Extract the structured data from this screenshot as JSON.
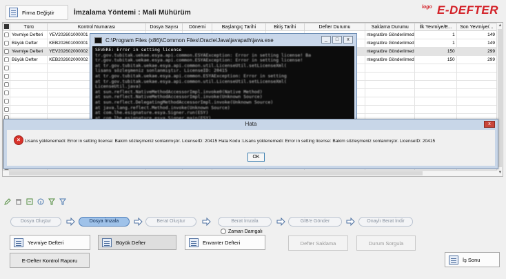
{
  "header": {
    "firm_button": "Firma Değiştir",
    "title": "İmzalama Yöntemi : Mali Mühürüm",
    "logo_small": "logo",
    "logo_big": "E-DEFTER"
  },
  "grid": {
    "columns": [
      "",
      "Türü",
      "Kontrol Numarası",
      "Dosya Sayısı",
      "Dönemi",
      "Başlangıç Tarihi",
      "Bitiş Tarihi",
      "Defter Durumu",
      "Saklama Durumu",
      "İlk Yevmiye/E...",
      "Son Yevmiye/..."
    ],
    "rows": [
      {
        "type": "Yevmiye Defteri",
        "control": "YEV202601000001",
        "saklama": "ntegratöre Gönderilmedi",
        "ilk": "1",
        "son": "149",
        "selected": false
      },
      {
        "type": "Büyük Defter",
        "control": "KEB202601000001",
        "saklama": "ntegratöre Gönderilmedi",
        "ilk": "1",
        "son": "149",
        "selected": false
      },
      {
        "type": "Yevmiye Defteri",
        "control": "YEV202602000002",
        "saklama": "ntegratöre Gönderilmedi",
        "ilk": "150",
        "son": "299",
        "selected": true
      },
      {
        "type": "Büyük Defter",
        "control": "KEB202602000002",
        "saklama": "ntegratöre Gönderilmedi",
        "ilk": "150",
        "son": "299",
        "selected": false
      }
    ],
    "empty_rows": 14
  },
  "console": {
    "title": "C:\\Program Files (x86)\\Common Files\\Oracle\\Java\\javapath\\java.exe",
    "first_line": "SEVERE: Error in setting license",
    "blurred_lines": [
      "tr.gov.tubitak.uekae.esya.api.common.ESYAException: Error in setting license! Ba",
      "tr.gov.tubitak.uekae.esya.api.common.ESYAException: Error in setting license!",
      "   at tr.gov.tubitak.uekae.esya.api.common.util.LicenseUtil.setLicenseXml(",
      "lisans sözleşmeniz sonlanmıştır. LicenseID: 20415",
      "   at tr.gov.tubitak.uekae.esya.api.common.ESYAException: Error in setting",
      "   at tr.gov.tubitak.uekae.esya.api.common.util.LicenseUtil.setLicenseXml(",
      "LicenseUtil.java)",
      "   at sun.reflect.NativeMethodAccessorImpl.invoke0(Native Method)",
      "   at sun.reflect.NativeMethodAccessorImpl.invoke(Unknown Source)",
      "   at sun.reflect.DelegatingMethodAccessorImpl.invoke(Unknown Source)",
      "   at java.lang.reflect.Method.invoke(Unknown Source)",
      "   at com.lhe.esignature.esya.Signer.run(ESY)",
      "   at com.lhe.esignature.esya.Signer.main(ESY)"
    ],
    "min": "_",
    "max": "□",
    "close": "x"
  },
  "dialog": {
    "title": "Hata",
    "close": "x",
    "message": "Lisans yüklenemedi: Error in setting license: Bakim sözleşmeniz sonlanmıştır. LicenseID: 20415 Hata Kodu :Lisans yüklenemedi: Error in setting license: Bakim sözleşmeniz sonlanmıştır. LicenseID: 20415",
    "ok": "OK"
  },
  "workflow": {
    "steps": [
      "Dosya Oluştur",
      "Dosya İmzala",
      "Berat Oluştur",
      "Berat İmzala",
      "GİB'e Gönder",
      "Onaylı Berat İndir"
    ],
    "active": "Dosya İmzala",
    "zaman_damgali": "Zaman Damgalı"
  },
  "actions": {
    "yevmiye": "Yevmiye Defteri",
    "buyuk": "Büyük Defter",
    "envanter": "Envanter Defteri",
    "saklama": "Defter Saklama",
    "sorgula": "Durum Sorgula",
    "rapor": "E-Defter Kontrol Raporu",
    "is_sonu": "İş Sonu"
  },
  "colors": {
    "brand_red": "#d31f26",
    "active_step": "#9fc2e9",
    "error_red": "#d9332b"
  }
}
